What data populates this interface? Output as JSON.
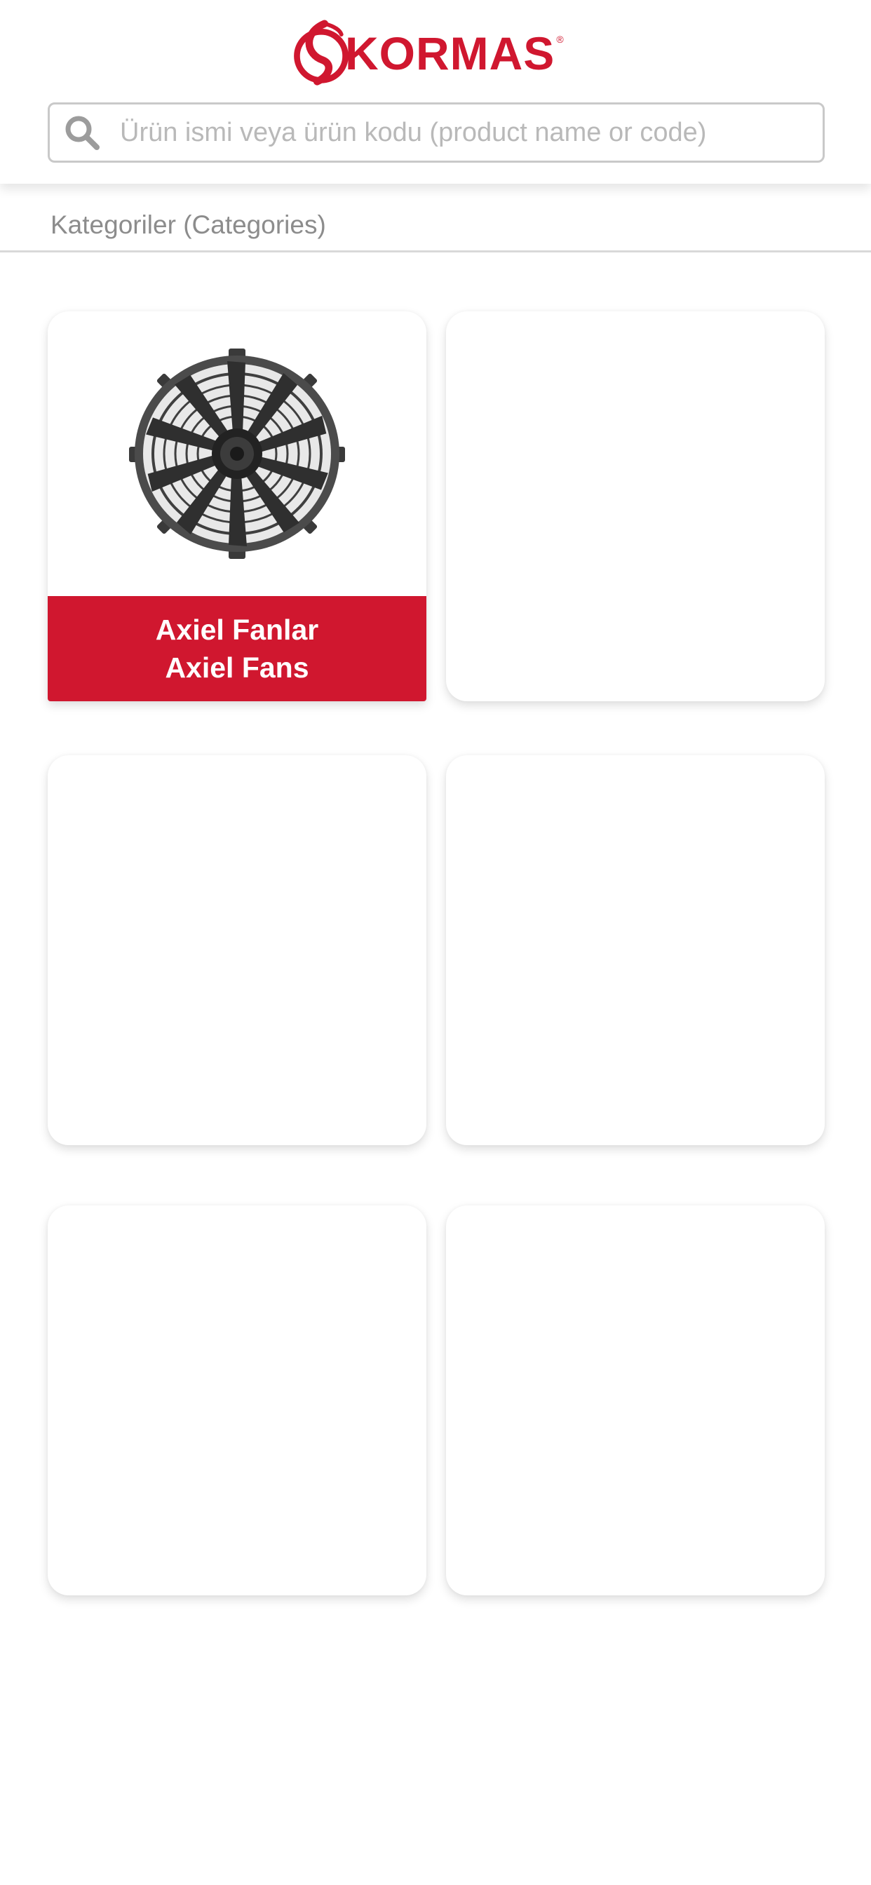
{
  "brand": {
    "name": "KORMAS",
    "registered_mark": "®",
    "color": "#d0172f"
  },
  "search": {
    "placeholder": "Ürün ismi veya ürün kodu (product name or code)",
    "value": ""
  },
  "categories_section": {
    "title": "Kategoriler (Categories)"
  },
  "categories": [
    {
      "label_tr": "Axiel Fanlar",
      "label_en": "Axiel Fans",
      "icon": "axial-fan-image"
    },
    {
      "label_tr": "",
      "label_en": ""
    },
    {
      "label_tr": "",
      "label_en": ""
    },
    {
      "label_tr": "",
      "label_en": ""
    },
    {
      "label_tr": "",
      "label_en": ""
    },
    {
      "label_tr": "",
      "label_en": ""
    }
  ],
  "colors": {
    "accent": "#d0172f",
    "muted_text": "#8c8c8c",
    "placeholder_text": "#b9b9b9"
  }
}
